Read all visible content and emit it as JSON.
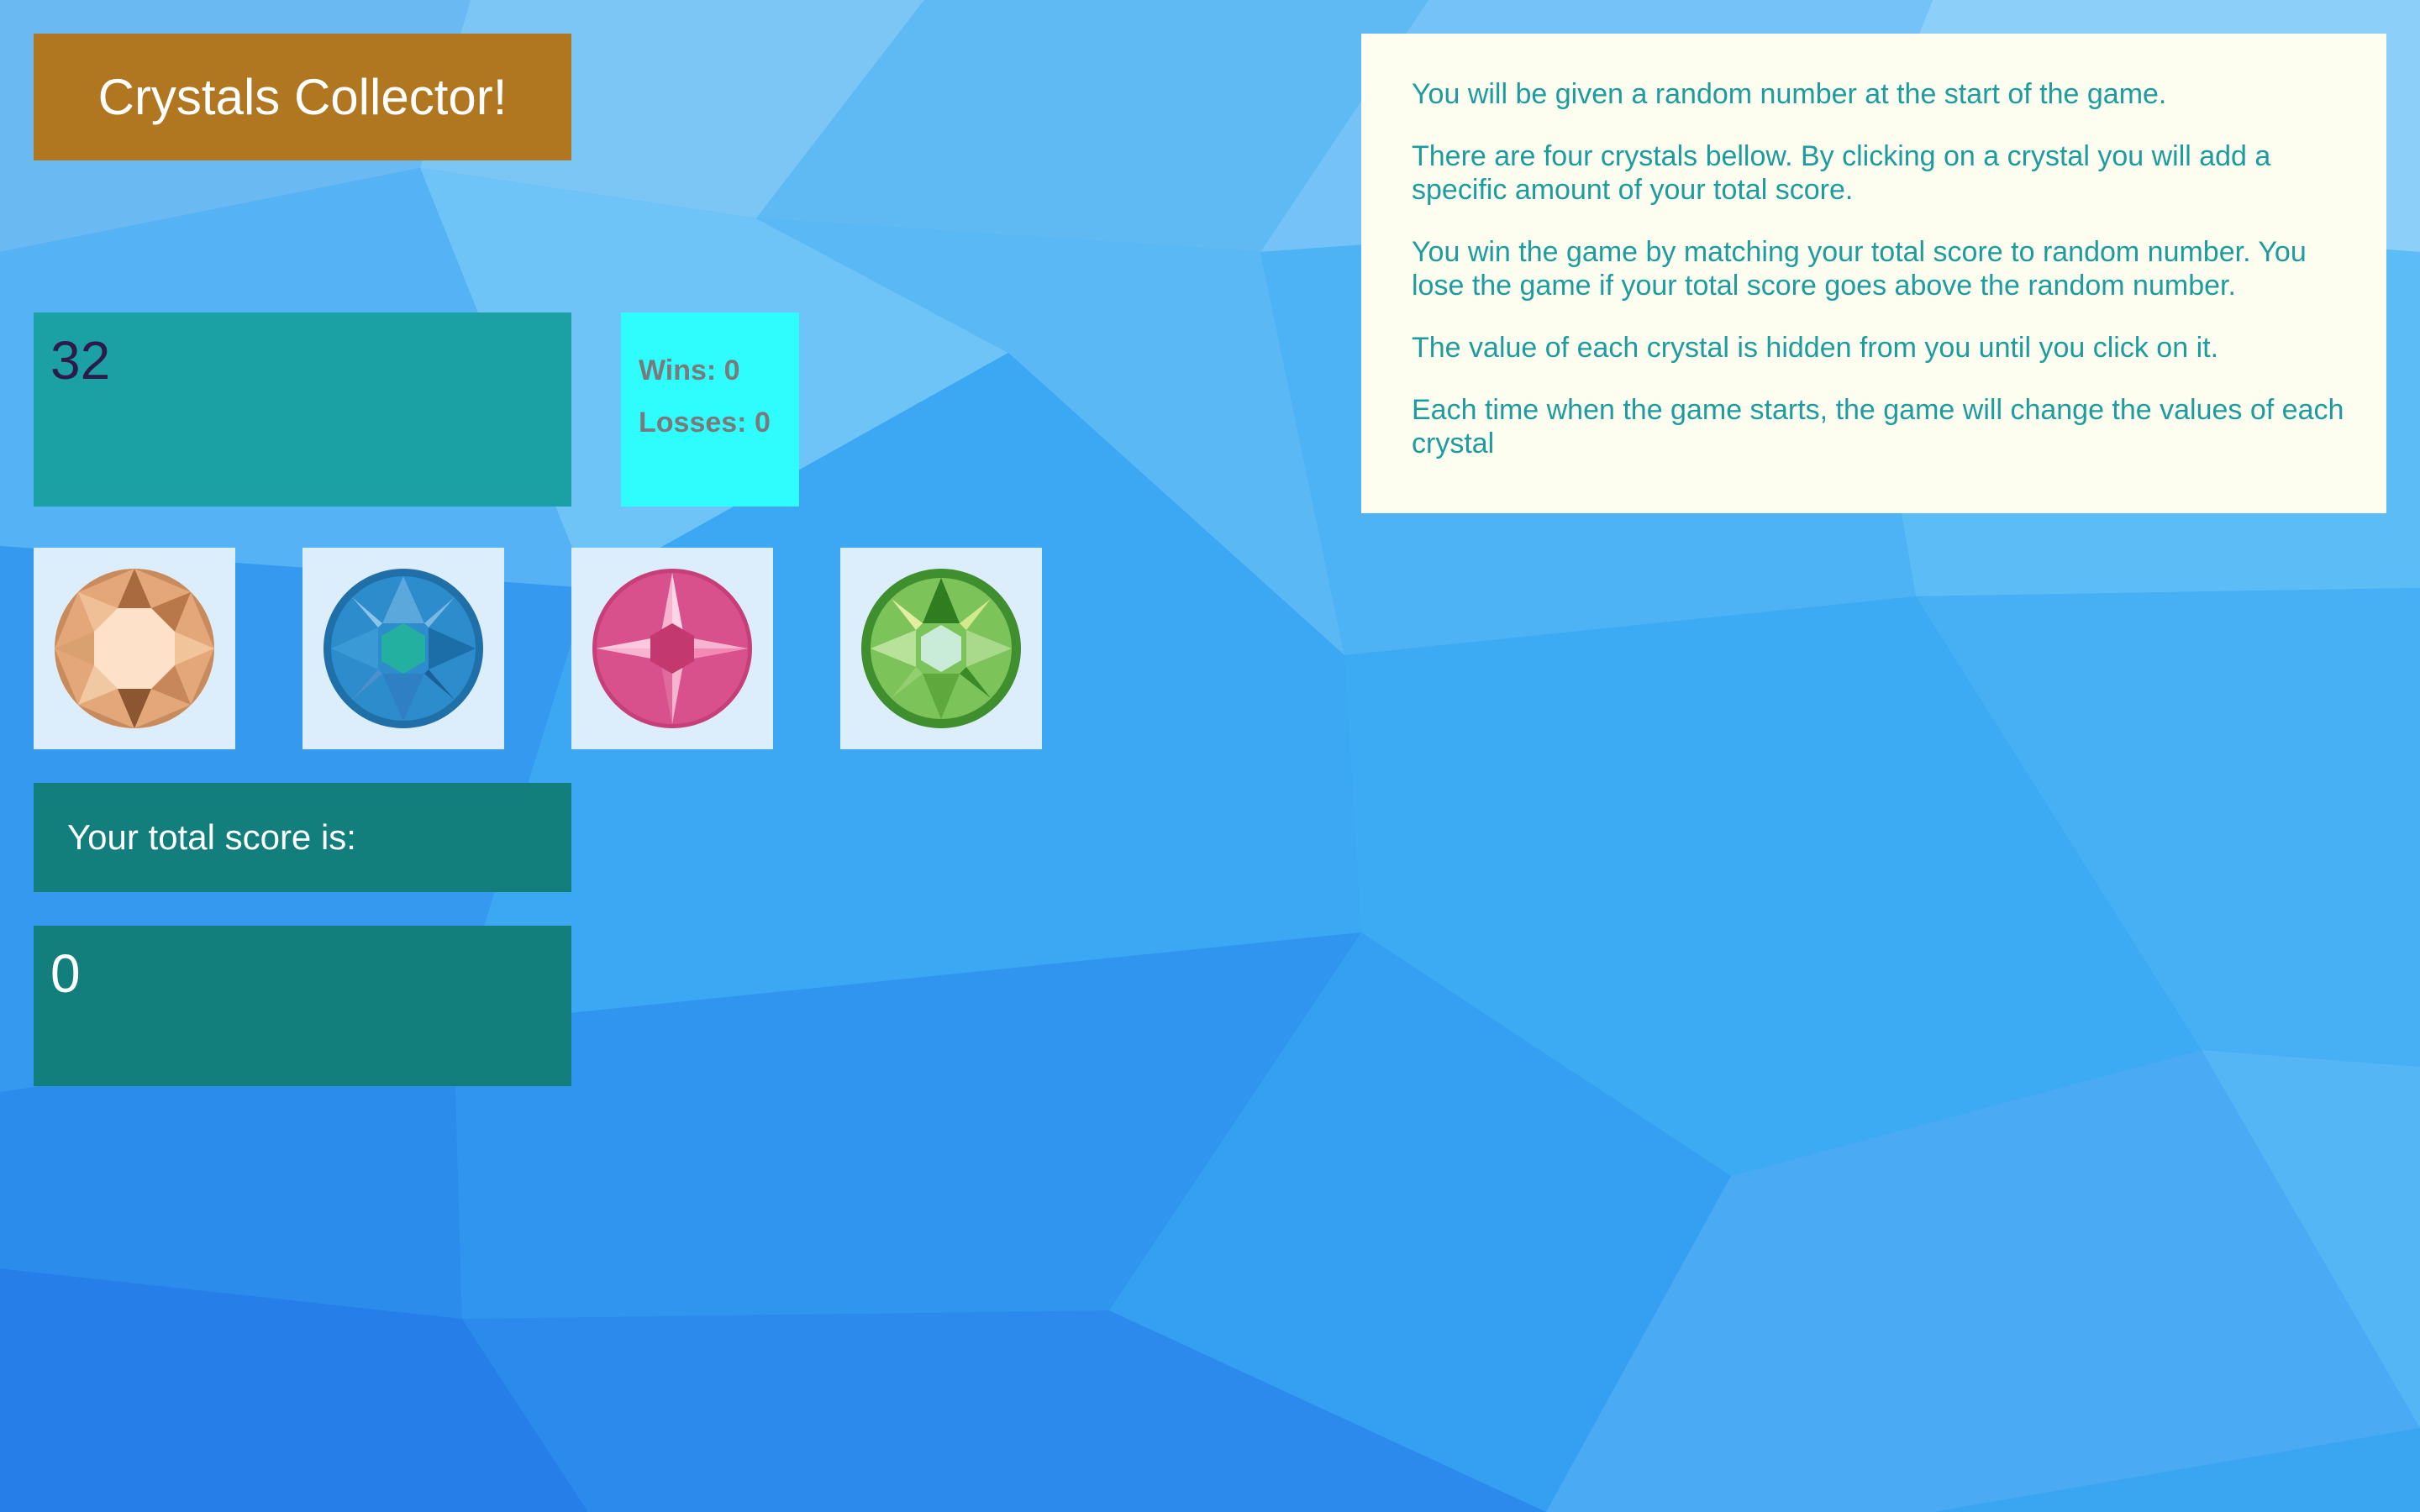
{
  "game": {
    "title": "Crystals Collector!",
    "target_number": "32",
    "wins_label": "Wins: 0",
    "losses_label": "Losses: 0",
    "total_score_label": "Your total score is:",
    "total_score": "0"
  },
  "crystals": [
    {
      "icon": "peach-crystal-icon",
      "color": "#e8b48a"
    },
    {
      "icon": "blue-crystal-icon",
      "color": "#2a8fc7"
    },
    {
      "icon": "pink-crystal-icon",
      "color": "#d64a86"
    },
    {
      "icon": "green-crystal-icon",
      "color": "#7cc35a"
    }
  ],
  "instructions": [
    "You will be given a random number at the start of the game.",
    "There are four crystals bellow. By clicking on a crystal you will add a specific amount of your total score.",
    "You win the game by matching your total score to random number. You lose the game if your total score goes above the random number.",
    "The value of each crystal is hidden from you until you click on it.",
    "Each time when the game starts, the game will change the values of each crystal"
  ],
  "colors": {
    "title_bg": "#b07620",
    "target_bg": "#1ba1a4",
    "stats_bg": "#2ffcfc",
    "score_bg": "#137f7d",
    "instructions_bg": "#fdfeef",
    "instructions_text": "#1d9c9f",
    "page_bg": "#3aa6f2"
  }
}
